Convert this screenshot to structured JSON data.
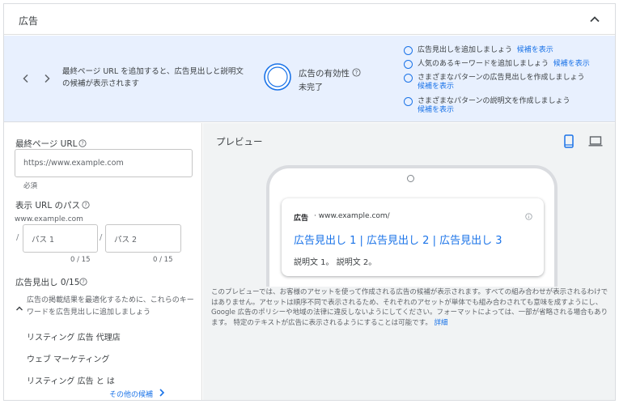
{
  "header": {
    "title": "広告",
    "collapse_icon": "chevron-up-icon"
  },
  "banner": {
    "description": "最終ページ URL を追加すると、広告見出しと説明文の候補が表示されます",
    "effectiveness_title": "広告の有効性",
    "effectiveness_status": "未完了",
    "suggestions": [
      {
        "text": "広告見出しを追加しましょう",
        "link": "候補を表示"
      },
      {
        "text": "人気のあるキーワードを追加しましょう",
        "link": "候補を表示"
      },
      {
        "text": "さまざまなパターンの広告見出しを作成しましょう",
        "link": "候補を表示"
      },
      {
        "text": "さまざまなパターンの説明文を作成しましょう",
        "link": "候補を表示"
      }
    ]
  },
  "form": {
    "final_url_label": "最終ページ URL",
    "final_url_placeholder": "https://www.example.com",
    "required_label": "必須",
    "display_path_label": "表示 URL のパス",
    "display_domain": "www.example.com",
    "path1_placeholder": "パス 1",
    "path2_placeholder": "パス 2",
    "path1_counter": "0 / 15",
    "path2_counter": "0 / 15",
    "headlines_label": "広告見出し 0/15",
    "headline_hint": "広告の掲載結果を最適化するために、これらのキーワードを広告見出しに追加しましょう",
    "keywords": [
      "リスティング 広告 代理店",
      "ウェブ マーケティング",
      "リスティング 広告 と は"
    ],
    "more_label": "その他の候補"
  },
  "preview": {
    "title": "プレビュー",
    "ad_tag": "広告",
    "ad_url": "· www.example.com/",
    "headline": "広告見出し 1 | 広告見出し 2 | 広告見出し 3",
    "description": "説明文 1。 説明文 2。",
    "disclaimer": "このプレビューでは、お客様のアセットを使って作成される広告の候補が表示されます。すべての組み合わせが表示されるわけではありません。アセットは順序不同で表示されるため、それぞれのアセットが単体でも組み合わされても意味を成すようにし、Google 広告のポリシーや地域の法律に違反しないようにしてください。フォーマットによっては、一部が省略される場合もあります。 特定のテキストが広告に表示されるようにすることは可能です。",
    "details_link": "詳細"
  },
  "colors": {
    "accent": "#1a73e8",
    "banner_bg": "#e8f0fe",
    "preview_bg": "#f1f3f4"
  }
}
